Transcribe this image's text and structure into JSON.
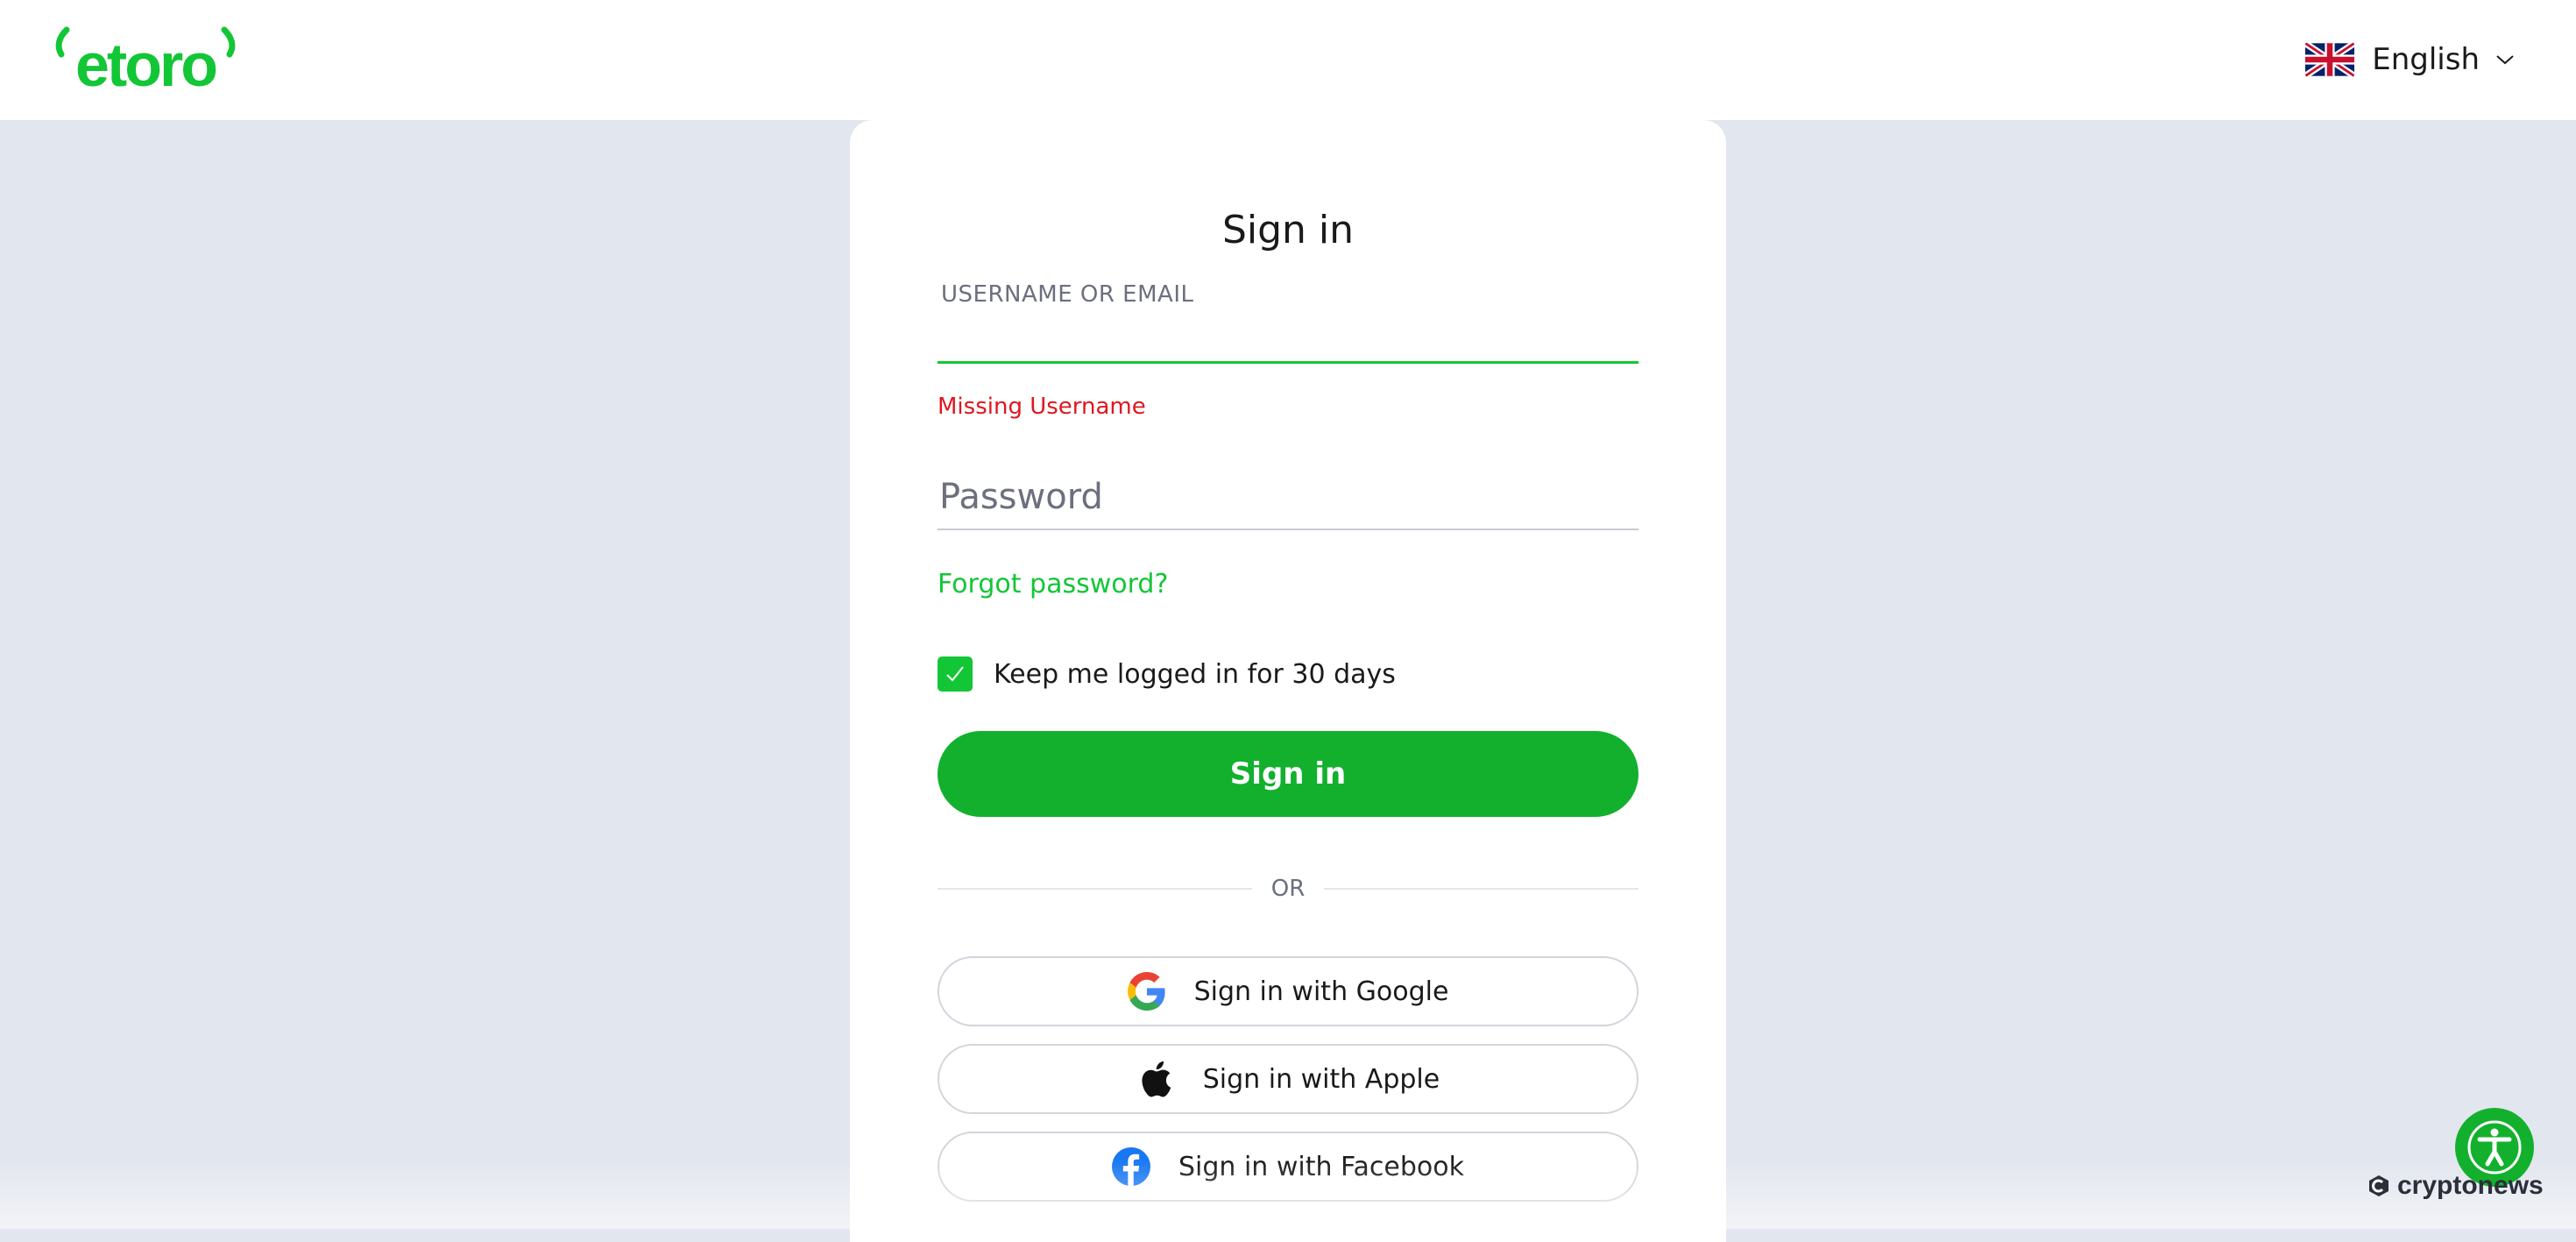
{
  "header": {
    "logo_text": "etoro",
    "language": "English",
    "flag_icon": "uk-flag-icon",
    "chevron_icon": "chevron-down-icon"
  },
  "signin_form": {
    "title": "Sign in",
    "username_label": "USERNAME OR EMAIL",
    "username_value": "",
    "username_error": "Missing Username",
    "password_placeholder": "Password",
    "password_value": "",
    "forgot_password": "Forgot password?",
    "keep_logged_in_label": "Keep me logged in for 30 days",
    "keep_logged_in_checked": true,
    "submit_label": "Sign in",
    "divider_text": "OR",
    "social": [
      {
        "label": "Sign in with Google",
        "icon": "google-icon"
      },
      {
        "label": "Sign in with Apple",
        "icon": "apple-icon"
      },
      {
        "label": "Sign in with Facebook",
        "icon": "facebook-icon"
      }
    ]
  },
  "accessibility": {
    "icon": "accessibility-icon"
  },
  "watermark": {
    "text": "cryptonews"
  },
  "colors": {
    "brand_green": "#13b02e",
    "error_red": "#e0171f",
    "background": "#e2e6ee"
  }
}
